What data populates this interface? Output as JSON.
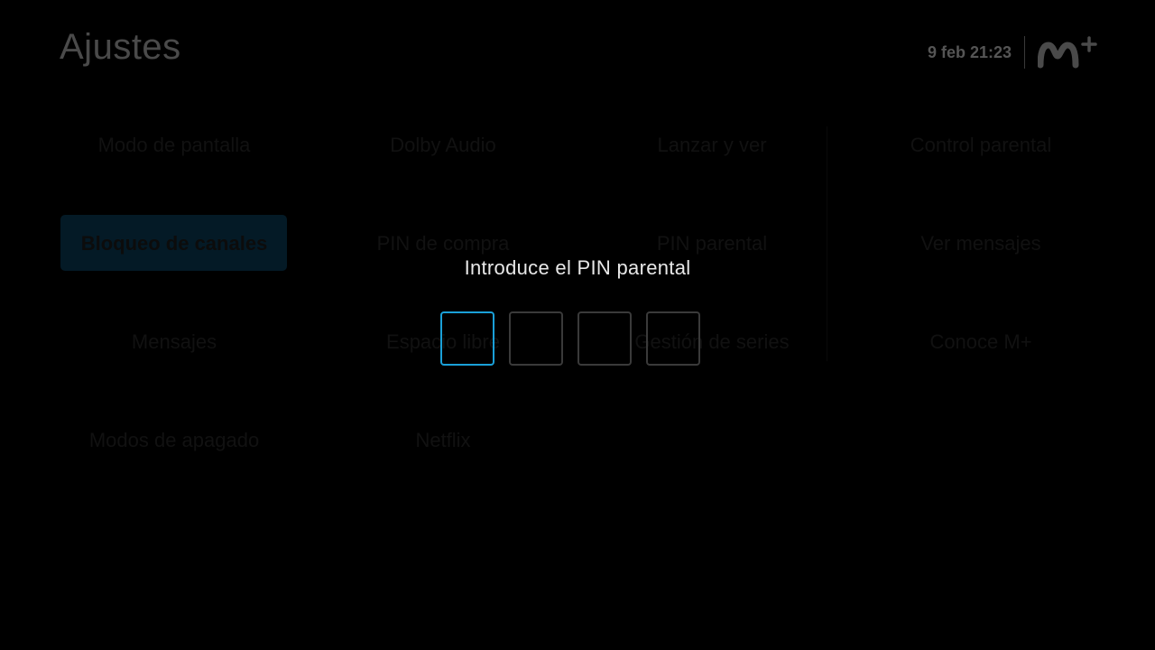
{
  "header": {
    "title": "Ajustes",
    "datetime": "9 feb 21:23",
    "logo_icon": "movistar-plus-logo"
  },
  "grid": {
    "rows": [
      [
        "Modo de pantalla",
        "Dolby Audio",
        "Lanzar y ver",
        "Control parental"
      ],
      [
        "Bloqueo de canales",
        "PIN de compra",
        "PIN parental",
        "Ver mensajes"
      ],
      [
        "Mensajes",
        "Espacio libre",
        "Gestión de series",
        "Conoce M+"
      ],
      [
        "Modos de apagado",
        "Netflix"
      ]
    ],
    "selected": "Bloqueo de canales"
  },
  "pin_dialog": {
    "title": "Introduce el PIN parental",
    "digits": [
      "",
      "",
      "",
      ""
    ],
    "active_index": 0
  },
  "colors": {
    "background": "#000000",
    "accent": "#1aa0d8",
    "pin_box_border": "#3a3a3a",
    "dialog_text": "#e8e8e8"
  }
}
